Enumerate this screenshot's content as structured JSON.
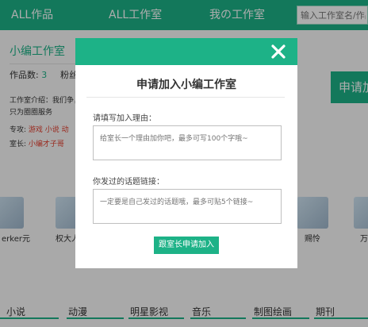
{
  "nav": {
    "items": [
      "ALL作品",
      "ALL工作室",
      "我の工作室"
    ],
    "search_placeholder": "输入工作室名/作品"
  },
  "studio": {
    "name": "小编工作室",
    "works_label": "作品数:",
    "works_count": "3",
    "fans_label": "粉丝",
    "intro_text": "工作室介绍：我们争，只为圈圈服务",
    "tags_label": "专攻:",
    "tags_value": "游戏 小说 动",
    "owner_label": "室长:",
    "owner_value": "小编才子哥",
    "apply_side_label": "申请加"
  },
  "members": [
    {
      "name": "erker元"
    },
    {
      "name": "权大人"
    },
    {
      "name": "赐怜"
    },
    {
      "name": "万"
    }
  ],
  "categories": [
    "小说",
    "动漫",
    "明星影视",
    "音乐",
    "制图绘画",
    "期刊"
  ],
  "modal": {
    "title": "申请加入小编工作室",
    "reason_label": "请填写加入理由：",
    "reason_placeholder": "给室长一个理由加你吧，最多可写100个字哦~",
    "links_label": "你发过的话题链接：",
    "links_placeholder": "一定要是自己发过的话题哦，最多可贴5个链接~",
    "submit_label": "跟室长申请加入"
  },
  "colors": {
    "brand": "#1db287",
    "tag_red": "#e23c2c"
  }
}
